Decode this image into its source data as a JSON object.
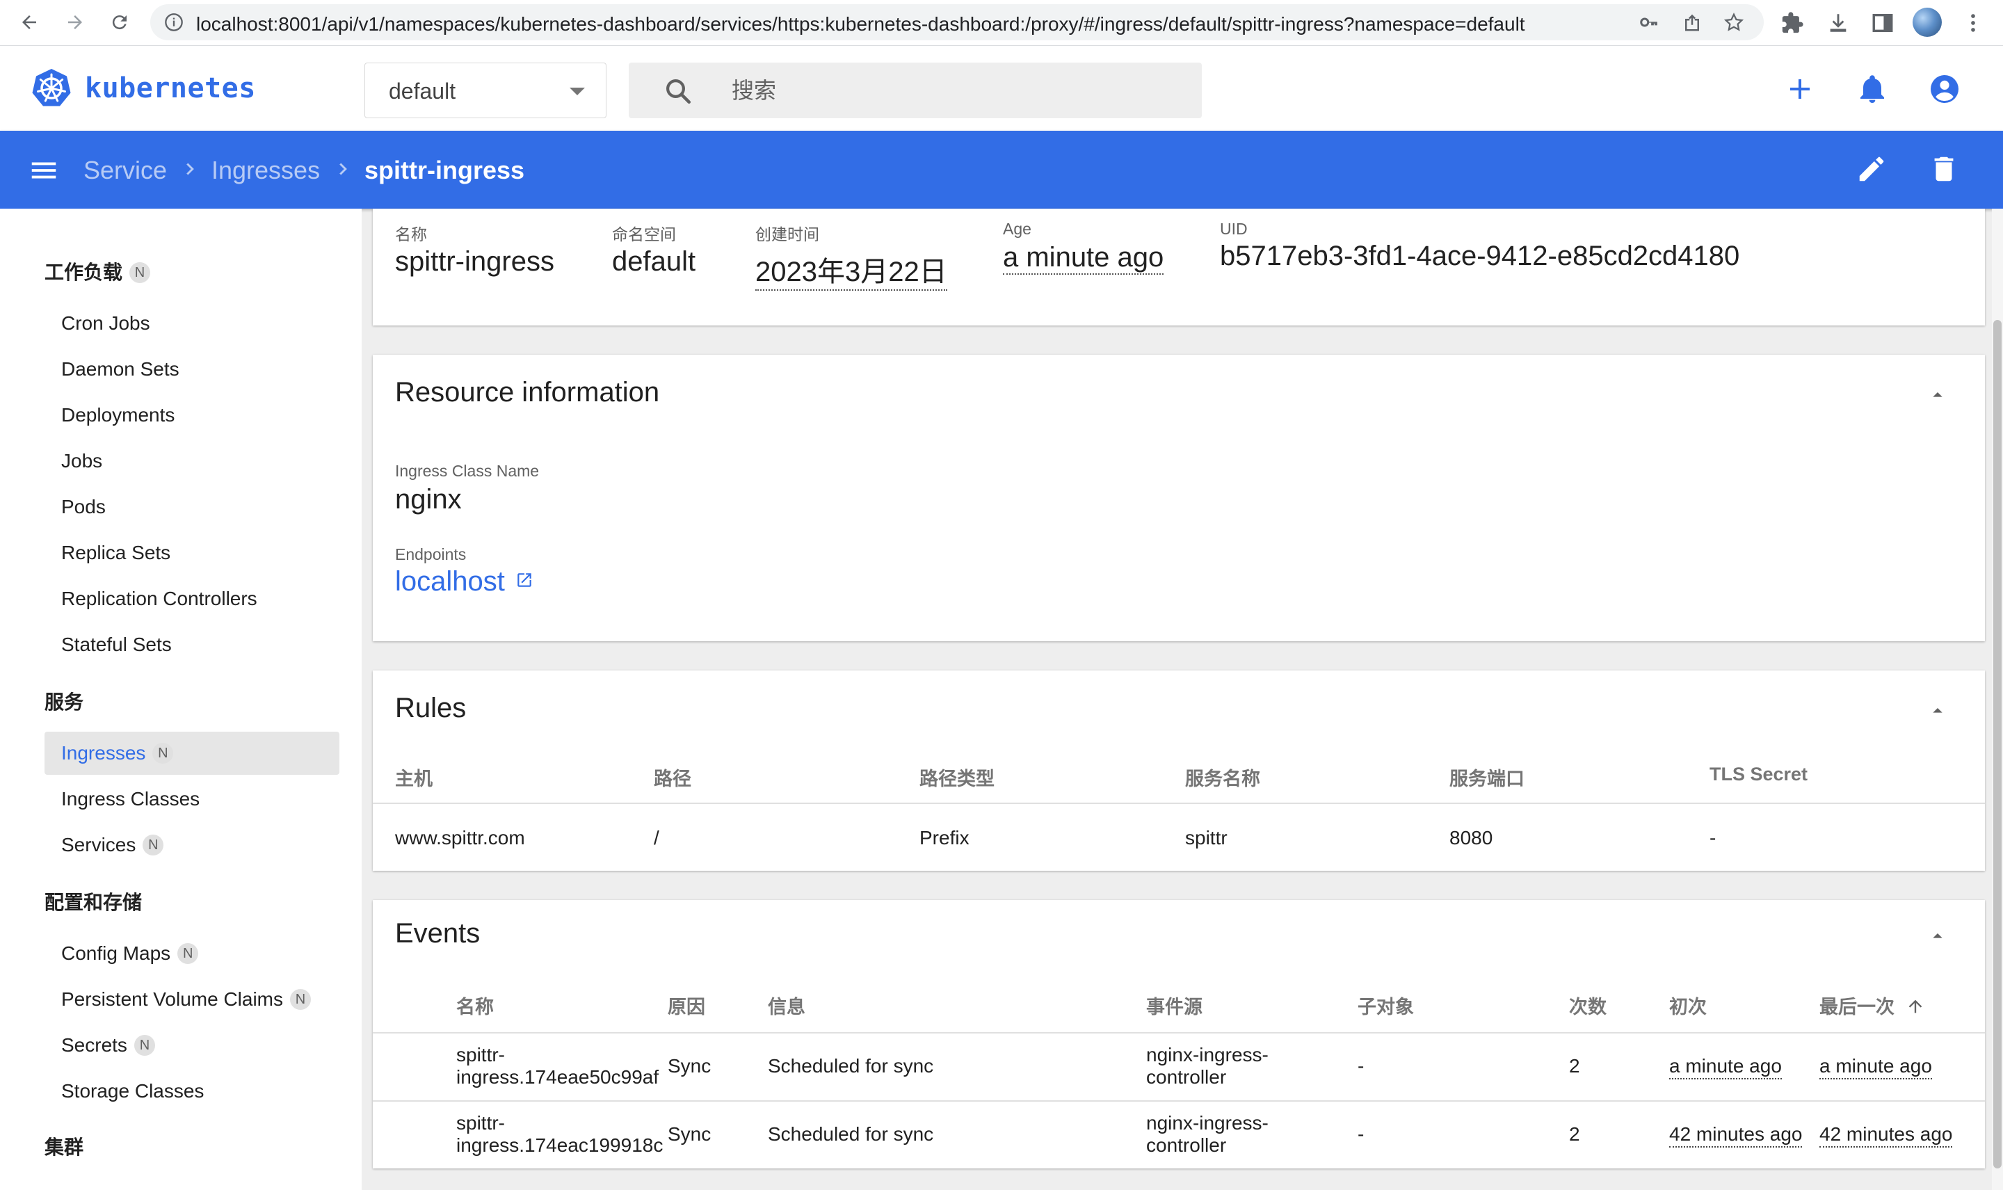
{
  "browser": {
    "url": "localhost:8001/api/v1/namespaces/kubernetes-dashboard/services/https:kubernetes-dashboard:/proxy/#/ingress/default/spittr-ingress?namespace=default"
  },
  "header": {
    "brand": "kubernetes",
    "namespace": "default",
    "search_placeholder": "搜索"
  },
  "breadcrumb": {
    "items": [
      "Service",
      "Ingresses"
    ],
    "current": "spittr-ingress"
  },
  "sidebar": {
    "sections": [
      {
        "title": "工作负载",
        "badge": "N",
        "items": [
          {
            "label": "Cron Jobs"
          },
          {
            "label": "Daemon Sets"
          },
          {
            "label": "Deployments"
          },
          {
            "label": "Jobs"
          },
          {
            "label": "Pods"
          },
          {
            "label": "Replica Sets"
          },
          {
            "label": "Replication Controllers"
          },
          {
            "label": "Stateful Sets"
          }
        ]
      },
      {
        "title": "服务",
        "items": [
          {
            "label": "Ingresses",
            "badge": "N",
            "active": true
          },
          {
            "label": "Ingress Classes"
          },
          {
            "label": "Services",
            "badge": "N"
          }
        ]
      },
      {
        "title": "配置和存储",
        "items": [
          {
            "label": "Config Maps",
            "badge": "N"
          },
          {
            "label": "Persistent Volume Claims",
            "badge": "N"
          },
          {
            "label": "Secrets",
            "badge": "N"
          },
          {
            "label": "Storage Classes"
          }
        ]
      },
      {
        "title": "集群",
        "items": []
      }
    ]
  },
  "metadata": {
    "name_label": "名称",
    "name": "spittr-ingress",
    "namespace_label": "命名空间",
    "namespace": "default",
    "created_label": "创建时间",
    "created": "2023年3月22日",
    "age_label": "Age",
    "age": "a minute ago",
    "uid_label": "UID",
    "uid": "b5717eb3-3fd1-4ace-9412-e85cd2cd4180"
  },
  "resource_info": {
    "title": "Resource information",
    "ingress_class_label": "Ingress Class Name",
    "ingress_class": "nginx",
    "endpoints_label": "Endpoints",
    "endpoint": "localhost"
  },
  "rules": {
    "title": "Rules",
    "headers": [
      "主机",
      "路径",
      "路径类型",
      "服务名称",
      "服务端口",
      "TLS Secret"
    ],
    "rows": [
      [
        "www.spittr.com",
        "/",
        "Prefix",
        "spittr",
        "8080",
        "-"
      ]
    ]
  },
  "events": {
    "title": "Events",
    "headers": [
      "名称",
      "原因",
      "信息",
      "事件源",
      "子对象",
      "次数",
      "初次",
      "最后一次"
    ],
    "rows": [
      {
        "name1": "spittr-",
        "name2": "ingress.174eae50c99af",
        "reason": "Sync",
        "message": "Scheduled for sync",
        "source1": "nginx-ingress-",
        "source2": "controller",
        "sub": "-",
        "count": "2",
        "first": "a minute ago",
        "last": "a minute ago"
      },
      {
        "name1": "spittr-",
        "name2": "ingress.174eac199918c",
        "reason": "Sync",
        "message": "Scheduled for sync",
        "source1": "nginx-ingress-",
        "source2": "controller",
        "sub": "-",
        "count": "2",
        "first": "42 minutes ago",
        "last": "42 minutes ago"
      }
    ]
  },
  "colors": {
    "brand_blue": "#326de6",
    "active_bg": "#e6e6e6"
  }
}
